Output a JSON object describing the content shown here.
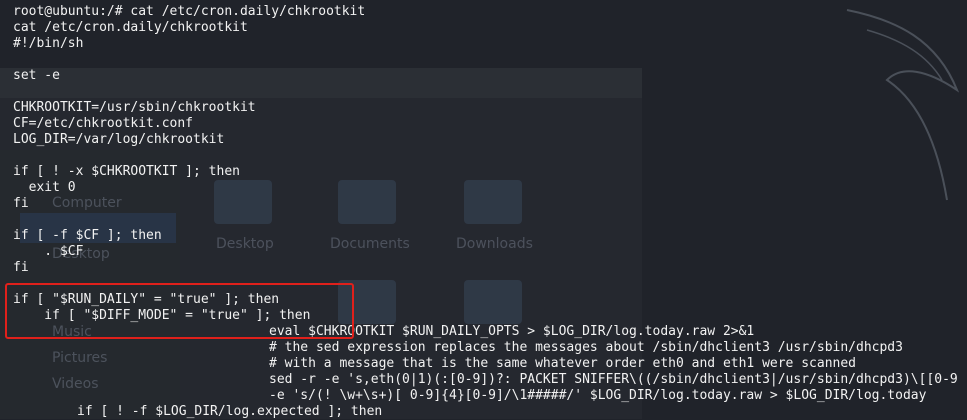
{
  "terminal": {
    "lines": [
      {
        "indent": 0,
        "text": "root@ubuntu:/# cat /etc/cron.daily/chkrootkit"
      },
      {
        "indent": 0,
        "text": "cat /etc/cron.daily/chkrootkit"
      },
      {
        "indent": 0,
        "text": "#!/bin/sh"
      },
      {
        "indent": 0,
        "text": ""
      },
      {
        "indent": 0,
        "text": "set -e"
      },
      {
        "indent": 0,
        "text": ""
      },
      {
        "indent": 0,
        "text": "CHKROOTKIT=/usr/sbin/chkrootkit"
      },
      {
        "indent": 0,
        "text": "CF=/etc/chkrootkit.conf"
      },
      {
        "indent": 0,
        "text": "LOG_DIR=/var/log/chkrootkit"
      },
      {
        "indent": 0,
        "text": ""
      },
      {
        "indent": 0,
        "text": "if [ ! -x $CHKROOTKIT ]; then"
      },
      {
        "indent": 0,
        "text": "  exit 0"
      },
      {
        "indent": 0,
        "text": "fi"
      },
      {
        "indent": 0,
        "text": ""
      },
      {
        "indent": 0,
        "text": "if [ -f $CF ]; then"
      },
      {
        "indent": 0,
        "text": "    . $CF"
      },
      {
        "indent": 0,
        "text": "fi"
      },
      {
        "indent": 0,
        "text": ""
      },
      {
        "indent": 0,
        "text": "if [ \"$RUN_DAILY\" = \"true\" ]; then"
      },
      {
        "indent": 0,
        "text": "    if [ \"$DIFF_MODE\" = \"true\" ]; then"
      },
      {
        "indent": 256,
        "text": "eval $CHKROOTKIT $RUN_DAILY_OPTS > $LOG_DIR/log.today.raw 2>&1"
      },
      {
        "indent": 256,
        "text": "# the sed expression replaces the messages about /sbin/dhclient3 /usr/sbin/dhcpd3"
      },
      {
        "indent": 256,
        "text": "# with a message that is the same whatever order eth0 and eth1 were scanned"
      },
      {
        "indent": 256,
        "text": "sed -r -e 's,eth(0|1)(:[0-9])?: PACKET SNIFFER\\((/sbin/dhclient3|/usr/sbin/dhcpd3)\\[[0-9"
      },
      {
        "indent": 256,
        "text": "-e 's/(! \\w+\\s+)[ 0-9]{4}[0-9]/\\1#####/' $LOG_DIR/log.today.raw > $LOG_DIR/log.today"
      },
      {
        "indent": 64,
        "text": "if [ ! -f $LOG_DIR/log.expected ]; then"
      }
    ]
  },
  "background": {
    "folder_computer": "Computer",
    "folder_desktop_side": "Desktop",
    "folder_desktop": "Desktop",
    "folder_documents": "Documents",
    "folder_downloads": "Downloads",
    "folder_music": "Music",
    "folder_pictures": "Pictures",
    "folder_videos": "Videos"
  }
}
